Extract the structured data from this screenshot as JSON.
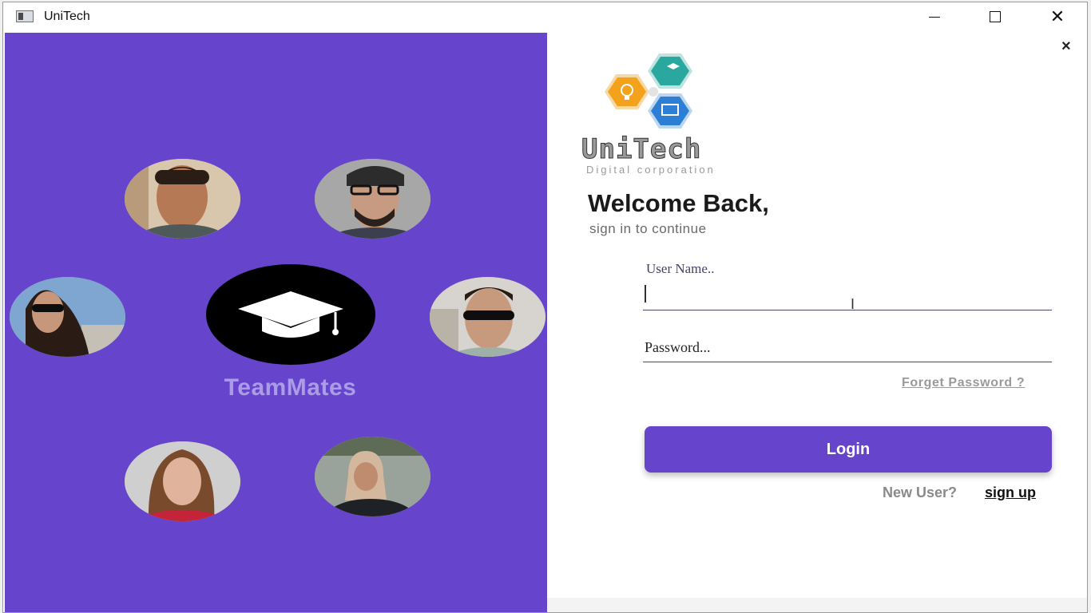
{
  "window": {
    "title": "UniTech",
    "minimize_icon": "minimize-icon",
    "maximize_icon": "maximize-icon",
    "close_icon": "close-icon"
  },
  "left_panel": {
    "background": "#6644cc",
    "avatars_count_shown": 6,
    "center_icon": "graduation-cap-icon",
    "caption": "TeamMates"
  },
  "right_panel": {
    "close_label": "×",
    "logo": {
      "name": "UniTech",
      "tagline": "Digital corporation",
      "icons": [
        "lightbulb-icon",
        "graduation-cap-icon",
        "code-monitor-icon"
      ],
      "hex_colors": [
        "#f4a21c",
        "#2aa8a0",
        "#2d7fd6"
      ]
    },
    "welcome_title": "Welcome Back,",
    "welcome_subtitle": "sign in to continue",
    "username": {
      "label": "User Name..",
      "value": ""
    },
    "password": {
      "placeholder": "Password...",
      "value": ""
    },
    "forget_password": "Forget Password ?",
    "login_label": "Login",
    "new_user_text": "New User?",
    "signup_label": "sign up",
    "accent": "#6644cc"
  }
}
